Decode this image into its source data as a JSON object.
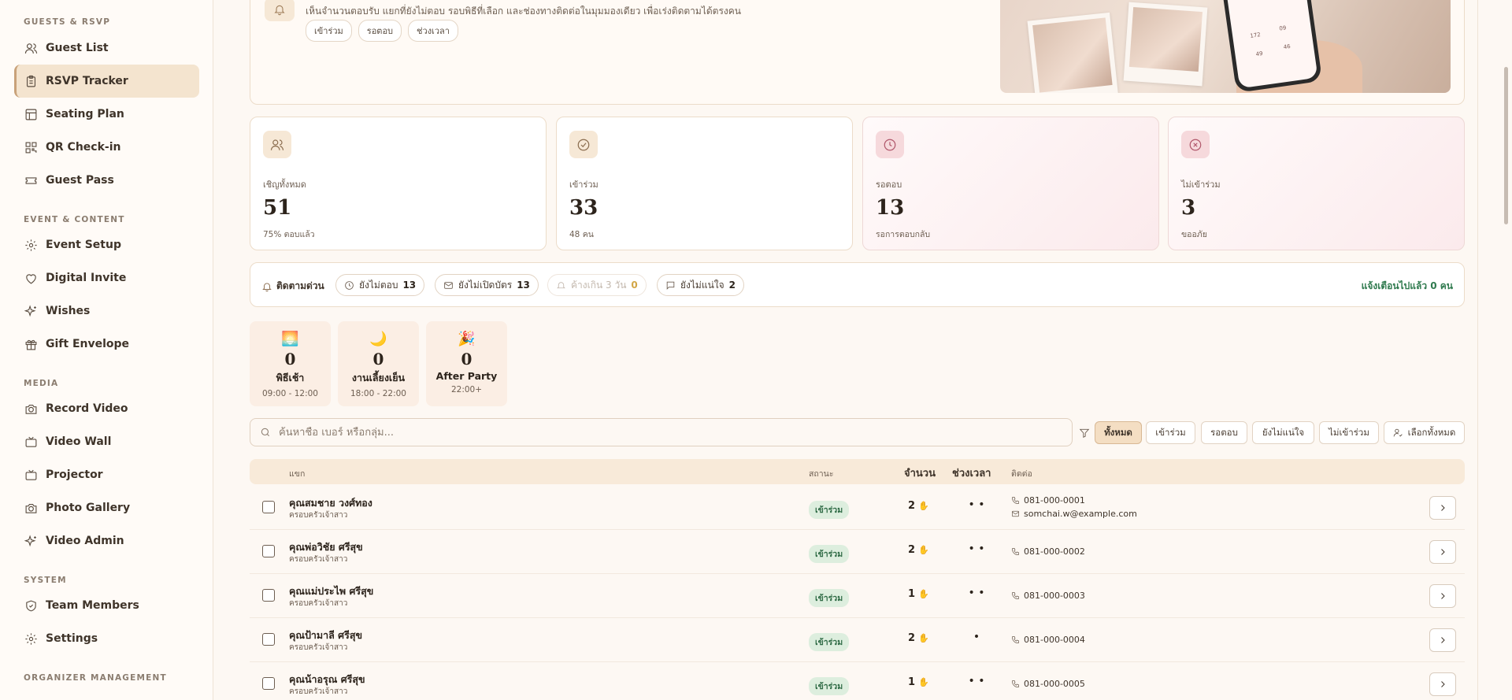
{
  "sidebar": {
    "sections": [
      {
        "label": "GUESTS & RSVP"
      },
      {
        "label": "EVENT & CONTENT"
      },
      {
        "label": "MEDIA"
      },
      {
        "label": "SYSTEM"
      },
      {
        "label": "ORGANIZER MANAGEMENT"
      }
    ],
    "items": [
      {
        "label": "Guest List",
        "icon": "users-icon"
      },
      {
        "label": "RSVP Tracker",
        "icon": "clipboard-icon",
        "active": true
      },
      {
        "label": "Seating Plan",
        "icon": "layout-icon"
      },
      {
        "label": "QR Check-in",
        "icon": "qr-icon"
      },
      {
        "label": "Guest Pass",
        "icon": "ticket-icon"
      },
      {
        "label": "Event Setup",
        "icon": "gear-icon"
      },
      {
        "label": "Digital Invite",
        "icon": "heart-icon"
      },
      {
        "label": "Wishes",
        "icon": "sparkles-icon"
      },
      {
        "label": "Gift Envelope",
        "icon": "gift-icon"
      },
      {
        "label": "Record Video",
        "icon": "camera-icon"
      },
      {
        "label": "Video Wall",
        "icon": "tv-icon"
      },
      {
        "label": "Projector",
        "icon": "monitor-icon"
      },
      {
        "label": "Photo Gallery",
        "icon": "camera-icon"
      },
      {
        "label": "Video Admin",
        "icon": "sparkles-icon"
      },
      {
        "label": "Team Members",
        "icon": "shield-icon"
      },
      {
        "label": "Settings",
        "icon": "gear-icon"
      }
    ]
  },
  "banner": {
    "text": "เห็นจำนวนตอบรับ แยกที่ยังไม่ตอบ รอบพิธีที่เลือก และช่องทางติดต่อในมุมมองเดียว เพื่อเร่งติดตามได้ตรงคน",
    "chips": [
      "เข้าร่วม",
      "รอตอบ",
      "ช่วงเวลา"
    ],
    "phone_numbers": [
      "172",
      "09",
      "49",
      "46"
    ]
  },
  "stats": [
    {
      "label": "เชิญทั้งหมด",
      "value": "51",
      "sub": "75% ตอบแล้ว",
      "icon": "users-icon",
      "color": "#f6e8d6"
    },
    {
      "label": "เข้าร่วม",
      "value": "33",
      "sub": "48 คน",
      "icon": "check-circle-icon",
      "color": "#f6e8d6"
    },
    {
      "label": "รอตอบ",
      "value": "13",
      "sub": "รอการตอบกลับ",
      "icon": "clock-icon",
      "color": "#f6d9dc"
    },
    {
      "label": "ไม่เข้าร่วม",
      "value": "3",
      "sub": "ขออภัย",
      "icon": "x-circle-icon",
      "color": "#f6d9dc"
    }
  ],
  "followup": {
    "title": "ติดตามด่วน",
    "chips": [
      {
        "label": "ยังไม่ตอบ",
        "count": "13",
        "icon": "clock-icon"
      },
      {
        "label": "ยังไม่เปิดบัตร",
        "count": "13",
        "icon": "mail-icon"
      },
      {
        "label": "ค้างเกิน 3 วัน",
        "count": "0",
        "icon": "bell-icon"
      },
      {
        "label": "ยังไม่แน่ใจ",
        "count": "2",
        "icon": "message-icon"
      }
    ],
    "notified": "แจ้งเตือนไปแล้ว 0 คน"
  },
  "slots": [
    {
      "emoji": "🌅",
      "count": "0",
      "name": "พิธีเช้า",
      "time": "09:00 - 12:00"
    },
    {
      "emoji": "🌙",
      "count": "0",
      "name": "งานเลี้ยงเย็น",
      "time": "18:00 - 22:00"
    },
    {
      "emoji": "🎉",
      "count": "0",
      "name": "After Party",
      "time": "22:00+"
    }
  ],
  "search": {
    "placeholder": "ค้นหาชื่อ เบอร์ หรือกลุ่ม..."
  },
  "filters": [
    "ทั้งหมด",
    "เข้าร่วม",
    "รอตอบ",
    "ยังไม่แน่ใจ",
    "ไม่เข้าร่วม"
  ],
  "select_all": "เลือกทั้งหมด",
  "table": {
    "headers": {
      "guest": "แขก",
      "status": "สถานะ",
      "qty": "จำนวน",
      "time": "ช่วงเวลา",
      "contact": "ติดต่อ"
    },
    "rows": [
      {
        "name": "คุณสมชาย วงศ์ทอง",
        "group": "ครอบครัวเจ้าสาว",
        "status": "เข้าร่วม",
        "qty": "2",
        "dots": "• •",
        "phone": "081-000-0001",
        "email": "somchai.w@example.com"
      },
      {
        "name": "คุณพ่อวิชัย ศรีสุข",
        "group": "ครอบครัวเจ้าสาว",
        "status": "เข้าร่วม",
        "qty": "2",
        "dots": "• •",
        "phone": "081-000-0002",
        "email": ""
      },
      {
        "name": "คุณแม่ประไพ ศรีสุข",
        "group": "ครอบครัวเจ้าสาว",
        "status": "เข้าร่วม",
        "qty": "1",
        "dots": "• •",
        "phone": "081-000-0003",
        "email": ""
      },
      {
        "name": "คุณป้ามาลี ศรีสุข",
        "group": "ครอบครัวเจ้าสาว",
        "status": "เข้าร่วม",
        "qty": "2",
        "dots": "•",
        "phone": "081-000-0004",
        "email": ""
      },
      {
        "name": "คุณน้าอรุณ ศรีสุข",
        "group": "ครอบครัวเจ้าสาว",
        "status": "เข้าร่วม",
        "qty": "1",
        "dots": "• •",
        "phone": "081-000-0005",
        "email": ""
      }
    ]
  }
}
